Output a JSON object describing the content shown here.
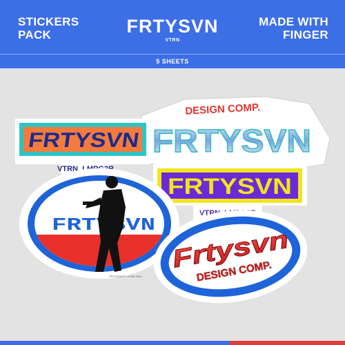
{
  "header": {
    "left_line1": "STICKERS",
    "left_line2": "PACK",
    "brand": "FRTYSVN",
    "brand_sub": "VTRN",
    "right_line1": "MADE WITH",
    "right_line2": "FINGER",
    "subtitle": "5 SHEETS"
  },
  "stickers": {
    "chrome": {
      "top_text": "DESIGN COMP.",
      "main_text": "FRTYSVN"
    },
    "orange": {
      "main_text": "FRTYSVN",
      "caption": "VTRN, LMPG2R"
    },
    "oval": {
      "main_text": "FRTYSVN",
      "fine_print": "FRTYSVN™ • VTRN 2024"
    },
    "purple": {
      "main_text": "FRTYSVN",
      "caption": "VTRN, LMPG2R"
    },
    "ellipse": {
      "main_text": "Frtysvn",
      "caption": "DESIGN COMP."
    }
  },
  "colors": {
    "brand_blue": "#3c6ee6",
    "accent_red": "#e03a3a",
    "orange": "#f27b3d",
    "teal": "#2ec4c6",
    "purple": "#6a2bd6",
    "yellow": "#f2e41f",
    "chrome": "#9ec0ef"
  }
}
